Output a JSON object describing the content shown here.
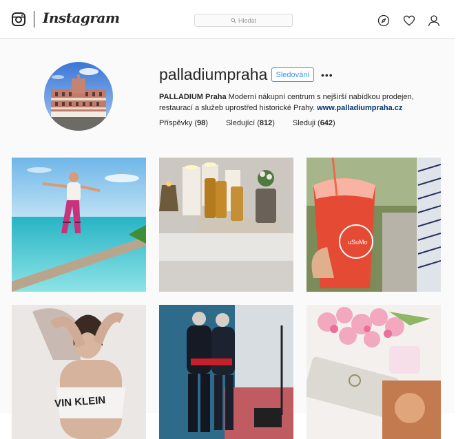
{
  "colors": {
    "accent": "#3897f0",
    "link": "#003569",
    "text": "#262626",
    "border": "#dbdbdb"
  },
  "nav": {
    "wordmark": "Instagram",
    "search_placeholder": "Hledat",
    "icons": [
      "instagram-glyph-icon",
      "search-icon",
      "explore-compass-icon",
      "heart-icon",
      "profile-icon"
    ]
  },
  "profile": {
    "username": "palladiumpraha",
    "follow_label": "Sledování",
    "more_label": "•••",
    "bio_name": "PALLADIUM Praha",
    "bio_text": " Moderní nákupní centrum s nejširší nabídkou prodejen, restaurací a služeb uprostřed historické Prahy. ",
    "bio_link": "www.palladiumpraha.cz",
    "stats": [
      {
        "label": "Příspěvky",
        "count": "98"
      },
      {
        "label": "Sledující",
        "count": "812"
      },
      {
        "label": "Sleduji",
        "count": "642"
      }
    ]
  },
  "posts": [
    {
      "subject": "yoga-on-palm-trunk"
    },
    {
      "subject": "candles-and-spa-oils"
    },
    {
      "subject": "strawberry-smoothie-cup"
    },
    {
      "subject": "calvin-klein-model"
    },
    {
      "subject": "fashion-mannequins"
    },
    {
      "subject": "flowers-and-clutch"
    }
  ]
}
